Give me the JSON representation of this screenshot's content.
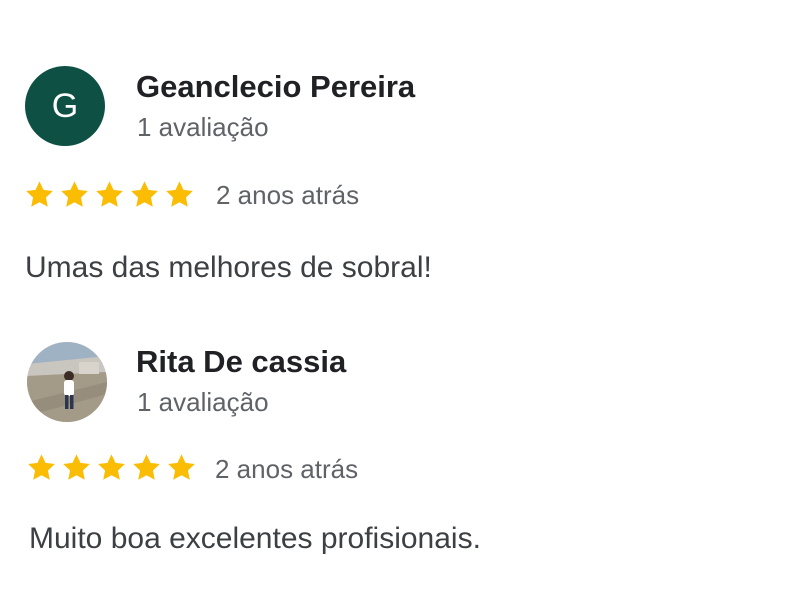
{
  "colors": {
    "star": "#fbbc04",
    "avatar_bg": "#0f5044"
  },
  "reviews": [
    {
      "avatar_letter": "G",
      "name": "Geanclecio Pereira",
      "review_count": "1 avaliação",
      "rating": 5,
      "time": "2 anos atrás",
      "text": "Umas das melhores de sobral!"
    },
    {
      "avatar_icon": "user-photo",
      "name": "Rita De cassia",
      "review_count": "1 avaliação",
      "rating": 5,
      "time": "2 anos atrás",
      "text": "Muito boa excelentes profisionais."
    }
  ]
}
